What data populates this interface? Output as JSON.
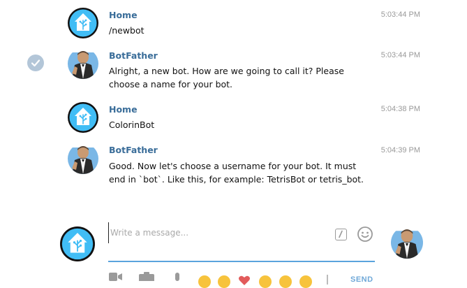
{
  "messages": [
    {
      "sender": "Home",
      "text": "/newbot",
      "time": "5:03:44 PM",
      "avatar": "home-assistant-avatar",
      "selected": false
    },
    {
      "sender": "BotFather",
      "text": "Alright, a new bot. How are we going to call it? Please choose a name for your bot.",
      "time": "5:03:44 PM",
      "avatar": "botfather-avatar",
      "selected": true
    },
    {
      "sender": "Home",
      "text": "ColorinBot",
      "time": "5:04:38 PM",
      "avatar": "home-assistant-avatar",
      "selected": false
    },
    {
      "sender": "BotFather",
      "text": "Good. Now let's choose a username for your bot. It must end in `bot`. Like this, for example: TetrisBot or tetris_bot.",
      "time": "5:04:39 PM",
      "avatar": "botfather-avatar",
      "selected": false
    }
  ],
  "composer": {
    "placeholder": "Write a message...",
    "value": "",
    "send_label": "SEND"
  },
  "icons": {
    "command": "bot-command-icon",
    "emoji": "emoji-smile-icon",
    "selected": "checkmark-icon",
    "attach": "camera-icon",
    "voice": "microphone-icon"
  },
  "colors": {
    "sender_name": "#3a6d99",
    "accent": "#5aa3dd",
    "home_avatar_bg": "#41bdf5",
    "timestamp": "#999999",
    "check_bg": "#b3c6d8"
  }
}
